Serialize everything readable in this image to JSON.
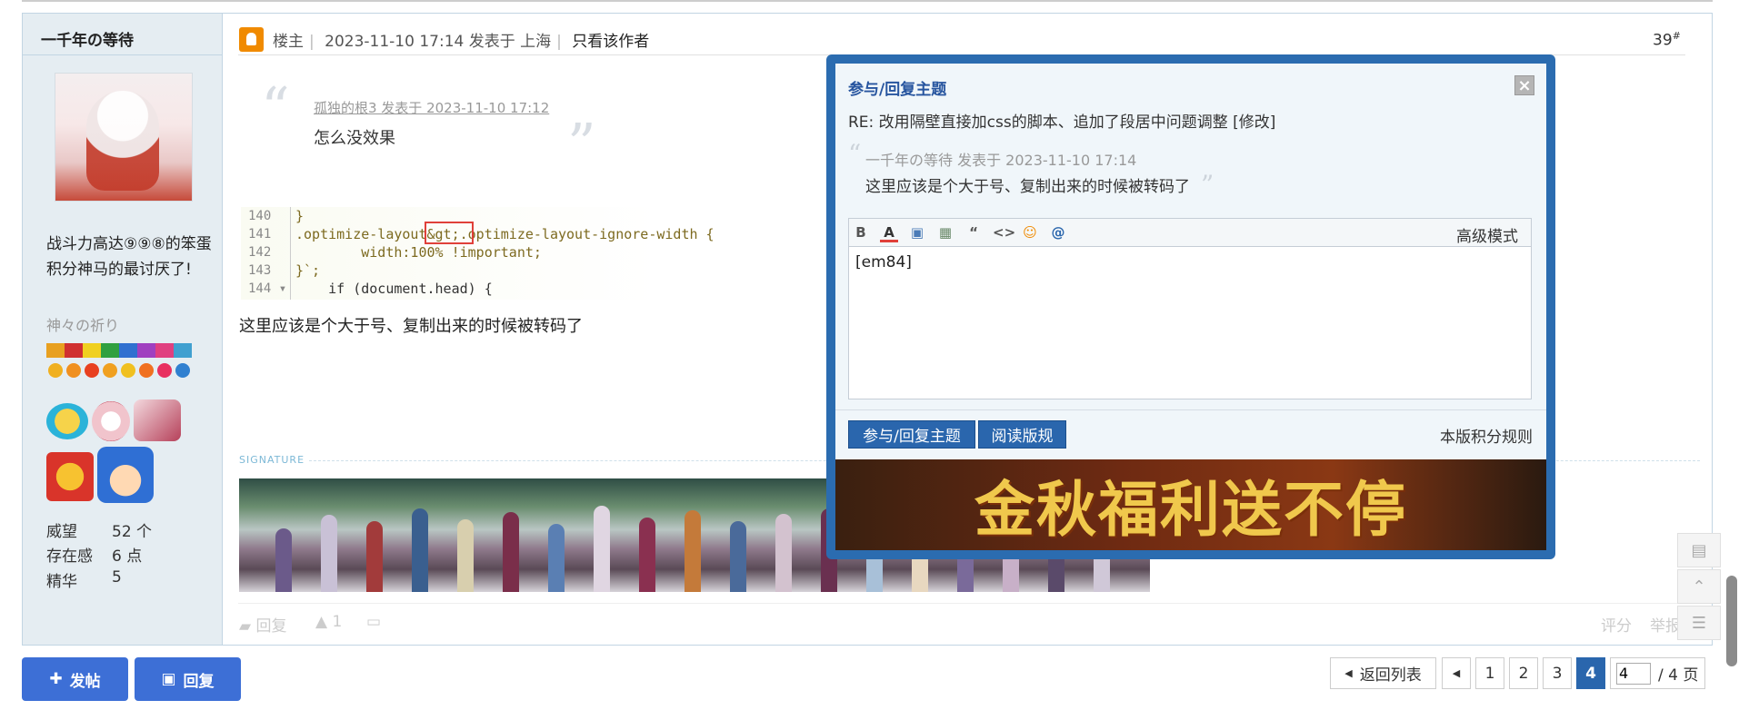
{
  "post": {
    "author": {
      "username": "一千年の等待",
      "bio": "战斗力高达⑨⑨⑧的笨蛋积分神马的最讨厌了!",
      "rank": "神々の祈り",
      "stats": [
        {
          "label": "威望",
          "value": "52 个"
        },
        {
          "label": "存在感",
          "value": "6 点"
        },
        {
          "label": "精华",
          "value": "5"
        }
      ]
    },
    "header": {
      "role": "楼主",
      "posted": "2023-11-10 17:14 发表于 上海",
      "only_author": "只看该作者",
      "floor": "39",
      "floor_sup": "#"
    },
    "quote": {
      "author_line": "孤独的根3 发表于 2023-11-10 17:12",
      "text": "怎么没效果"
    },
    "code_lines": [
      {
        "num": "140",
        "text": "}"
      },
      {
        "num": "141",
        "text": ".optimize-layout&gt;.optimize-layout-ignore-width {"
      },
      {
        "num": "142",
        "text": "        width:100% !important;"
      },
      {
        "num": "143",
        "text": "}`;"
      },
      {
        "num": "144 ▾",
        "text": "    if (document.head) {"
      }
    ],
    "body_text": "这里应该是个大于号、复制出来的时候被转码了",
    "signature_label": "SIGNATURE",
    "footer": {
      "reply": "回复",
      "like_count": "1",
      "rate": "评分",
      "report": "举报"
    }
  },
  "bottom_bar": {
    "post_button": "发帖",
    "reply_button": "回复",
    "back_to_list": "返回列表",
    "pages": [
      "1",
      "2",
      "3",
      "4"
    ],
    "current_page": "4",
    "page_input_value": "4",
    "total_pages": "/ 4 页"
  },
  "dialog": {
    "title": "参与/回复主题",
    "close": "×",
    "re_title": "RE: 改用隔壁直接加css的脚本、追加了段居中问题调整 [修改]",
    "quote_open": "“",
    "quote_close": "”",
    "quote_author": "一千年の等待 发表于 2023-11-10 17:14",
    "quote_text": "这里应该是个大于号、复制出来的时候被转码了",
    "toolbar": [
      "B",
      "A",
      "▣",
      "▦",
      "“",
      "<>",
      "☺",
      "@"
    ],
    "advanced_mode": "高级模式",
    "editor_value": "[em84]",
    "submit_button": "参与/回复主题",
    "rules_button": "阅读版规",
    "score_rules": "本版积分规则",
    "promo_text": "金秋福利送不停"
  },
  "icons": {
    "float_buttons": [
      "comment-icon",
      "back-to-top-icon",
      "list-icon"
    ]
  },
  "colors": {
    "accent": "#3d6fd6",
    "dialog_border": "#2b6cb0",
    "current_page": "#2a66ad"
  }
}
